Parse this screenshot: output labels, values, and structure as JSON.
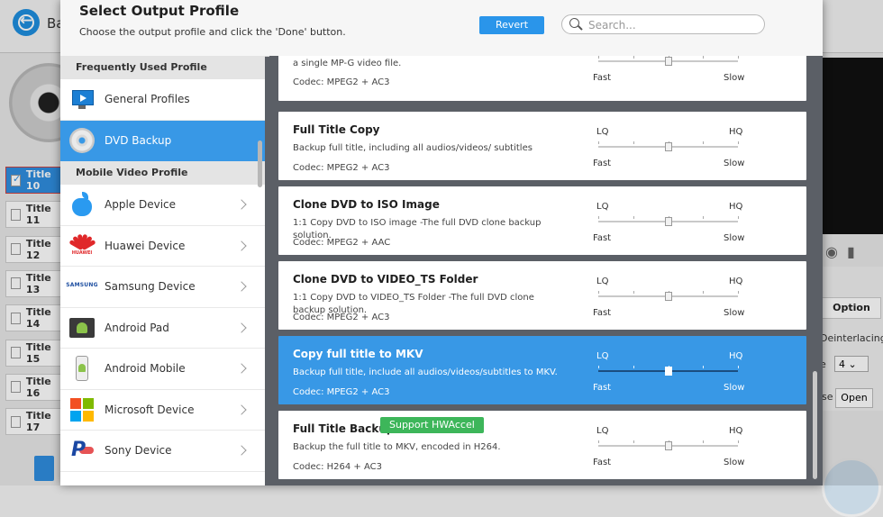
{
  "background": {
    "back_label": "Ba",
    "titles": [
      {
        "label": "Title 10",
        "checked": true
      },
      {
        "label": "Title 11",
        "checked": false
      },
      {
        "label": "Title 12",
        "checked": false
      },
      {
        "label": "Title 13",
        "checked": false
      },
      {
        "label": "Title 14",
        "checked": false
      },
      {
        "label": "Title 15",
        "checked": false
      },
      {
        "label": "Title 16",
        "checked": false
      },
      {
        "label": "Title 17",
        "checked": false
      }
    ],
    "option_label": "Option",
    "deinterlacing_label": "Deinterlacing",
    "e_label": "e",
    "select_value": "4",
    "se_label": "se",
    "open_label": "Open"
  },
  "modal": {
    "title": "Select Output Profile",
    "subtitle": "Choose the output profile and click the 'Done' button.",
    "revert_label": "Revert",
    "search_placeholder": "Search...",
    "sections": [
      {
        "header": "Frequently Used Profile",
        "items": [
          {
            "label": "General Profiles",
            "icon": "monitor-icon",
            "selected": false,
            "chevron": false
          },
          {
            "label": "DVD Backup",
            "icon": "dvd-disc-icon",
            "selected": true,
            "chevron": false
          }
        ]
      },
      {
        "header": "Mobile Video Profile",
        "items": [
          {
            "label": "Apple Device",
            "icon": "apple-icon",
            "selected": false,
            "chevron": true
          },
          {
            "label": "Huawei Device",
            "icon": "huawei-icon",
            "selected": false,
            "chevron": true
          },
          {
            "label": "Samsung Device",
            "icon": "samsung-icon",
            "selected": false,
            "chevron": true
          },
          {
            "label": "Android Pad",
            "icon": "android-pad-icon",
            "selected": false,
            "chevron": true
          },
          {
            "label": "Android Mobile",
            "icon": "android-phone-icon",
            "selected": false,
            "chevron": true
          },
          {
            "label": "Microsoft Device",
            "icon": "microsoft-icon",
            "selected": false,
            "chevron": true
          },
          {
            "label": "Sony Device",
            "icon": "sony-playstation-icon",
            "selected": false,
            "chevron": true
          }
        ]
      }
    ],
    "profiles": [
      {
        "title": "",
        "description": "Copy and save the DVD with selected audio/video tracks as a single MP-G video file.",
        "codec": "Codec: MPEG2 + AC3",
        "quality_low": "",
        "quality_high": "",
        "speed_low": "Fast",
        "speed_high": "Slow",
        "slider_level": 0.5,
        "selected": false,
        "badge": ""
      },
      {
        "title": "Full Title Copy",
        "description": "Backup full title, including all audios/videos/ subtitles",
        "codec": "Codec: MPEG2 + AC3",
        "quality_low": "LQ",
        "quality_high": "HQ",
        "speed_low": "Fast",
        "speed_high": "Slow",
        "slider_level": 0.5,
        "selected": false,
        "badge": ""
      },
      {
        "title": "Clone DVD to ISO Image",
        "description": "1:1 Copy DVD to ISO image -The full DVD clone backup solution.",
        "codec": "Codec: MPEG2 + AAC",
        "quality_low": "LQ",
        "quality_high": "HQ",
        "speed_low": "Fast",
        "speed_high": "Slow",
        "slider_level": 0.5,
        "selected": false,
        "badge": ""
      },
      {
        "title": "Clone DVD to VIDEO_TS Folder",
        "description": "1:1 Copy DVD to VIDEO_TS Folder -The full DVD clone backup solution.",
        "codec": "Codec: MPEG2 + AC3",
        "quality_low": "LQ",
        "quality_high": "HQ",
        "speed_low": "Fast",
        "speed_high": "Slow",
        "slider_level": 0.5,
        "selected": false,
        "badge": ""
      },
      {
        "title": "Copy full title to MKV",
        "description": "Backup full title, include all audios/videos/subtitles to MKV.",
        "codec": "Codec: MPEG2 + AC3",
        "quality_low": "LQ",
        "quality_high": "HQ",
        "speed_low": "Fast",
        "speed_high": "Slow",
        "slider_level": 0.5,
        "selected": true,
        "badge": ""
      },
      {
        "title": "Full Title Backup",
        "description": "Backup the full title to MKV, encoded in H264.",
        "codec": "Codec: H264 + AC3",
        "quality_low": "LQ",
        "quality_high": "HQ",
        "speed_low": "Fast",
        "speed_high": "Slow",
        "slider_level": 0.5,
        "selected": false,
        "badge": "Support HWAccel"
      }
    ]
  },
  "colors": {
    "accent": "#3898e6",
    "badge_green": "#3db65a",
    "modal_bg": "#5b5f66"
  }
}
